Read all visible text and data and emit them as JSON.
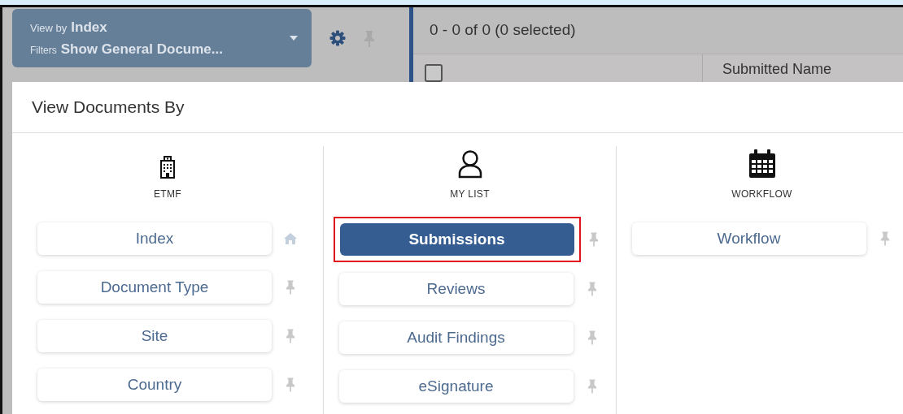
{
  "toolbar": {
    "view_by_label": "View by",
    "view_by_value": "Index",
    "filters_label": "Filters",
    "filters_value": "Show General Docume..."
  },
  "grid": {
    "count": "0 - 0 of 0 (0 selected)",
    "select_all_checked": false,
    "columns": [
      "Submitted Name"
    ]
  },
  "dialog": {
    "title": "View Documents By",
    "groups": [
      {
        "label": "ETMF",
        "kind": "building",
        "items": [
          {
            "label": "Index",
            "selected": false,
            "highlighted": false,
            "kind": "home"
          },
          {
            "label": "Document Type",
            "selected": false,
            "highlighted": false,
            "kind": "pin"
          },
          {
            "label": "Site",
            "selected": false,
            "highlighted": false,
            "kind": "pin"
          },
          {
            "label": "Country",
            "selected": false,
            "highlighted": false,
            "kind": "pin"
          }
        ]
      },
      {
        "label": "MY LIST",
        "kind": "user",
        "items": [
          {
            "label": "Submissions",
            "selected": true,
            "highlighted": true,
            "kind": "pin"
          },
          {
            "label": "Reviews",
            "selected": false,
            "highlighted": false,
            "kind": "pin"
          },
          {
            "label": "Audit Findings",
            "selected": false,
            "highlighted": false,
            "kind": "pin"
          },
          {
            "label": "eSignature",
            "selected": false,
            "highlighted": false,
            "kind": "pin"
          }
        ]
      },
      {
        "label": "WORKFLOW",
        "kind": "calendar",
        "items": [
          {
            "label": "Workflow",
            "selected": false,
            "highlighted": false,
            "kind": "pin"
          }
        ]
      }
    ]
  }
}
